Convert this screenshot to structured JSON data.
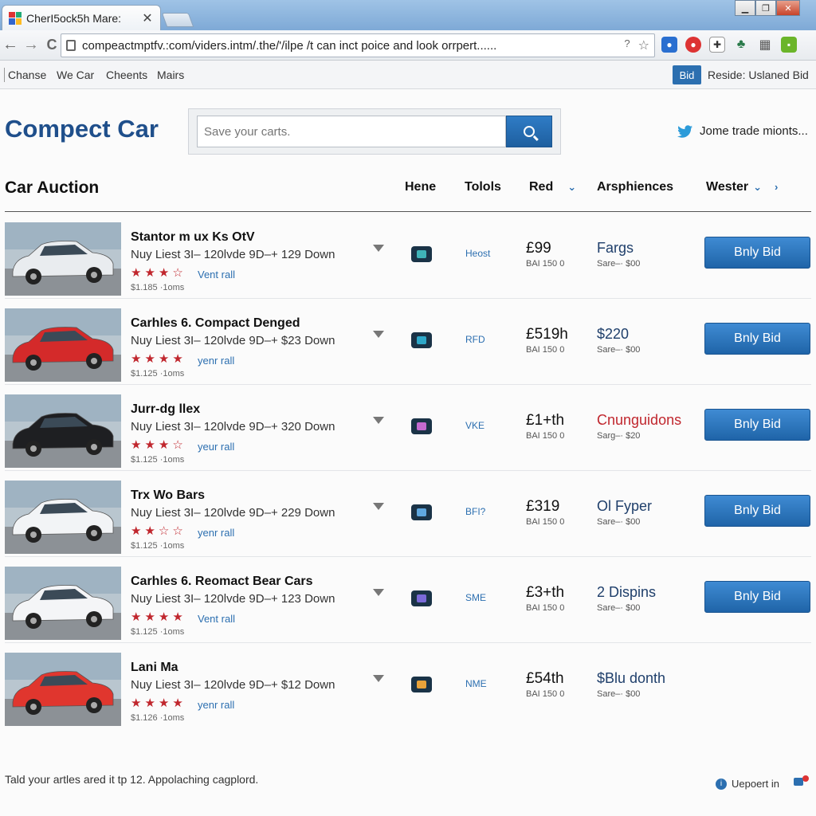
{
  "browser": {
    "tab_title": "CherI5ock5h Mare:",
    "tab_close": "✕",
    "url": "compeactmptfv.:com/viders.intm/.the/'/ilpe /t can inct poice and look orrpert......",
    "url_question": "?",
    "url_star": "☆",
    "nav_back": "←",
    "nav_forward": "→",
    "nav_reload": "C"
  },
  "bookmarks": [
    "Chanse",
    "We Car",
    "Cheents",
    "Mairs"
  ],
  "bookmark_bar": {
    "bid_badge": "Bid",
    "reside": "Reside: Uslaned Bid"
  },
  "header": {
    "logo": "Compect Car",
    "search_placeholder": "Save your carts.",
    "twitter_text": "Jome trade mionts..."
  },
  "section": {
    "title": "Car Auction",
    "columns": [
      "Hene",
      "Tolols",
      "Red",
      "Arsphiences",
      "Wester"
    ]
  },
  "listings": [
    {
      "title": "Stantor m ux Ks OtV",
      "subtitle": "Nuy Liest 3I– 120lvde 9D–+ 129 Down",
      "rating": 3,
      "rating_link": "Vent rall",
      "meta": "$1.185 ·1oms",
      "code": "Heost",
      "price": "£99",
      "price_sub": "BAI 150 0",
      "info": "Fargs",
      "info_sub": "Sare–· $00",
      "bid_label": "Bnly Bid",
      "car_color": "#e9ecef",
      "icon_color": "#3fb3b8"
    },
    {
      "title": "Carhles 6. Compact Denged",
      "subtitle": "Nuy Liest 3I– 120lvde 9D–+ $23 Down",
      "rating": 4,
      "rating_link": "yenr rall",
      "meta": "$1.125 ·1oms",
      "code": "RFD",
      "price": "£519h",
      "price_sub": "BAI 150 0",
      "info": "$220",
      "info_sub": "Sare–· $00",
      "bid_label": "Bnly Bid",
      "car_color": "#d42a2a",
      "icon_color": "#2ea8c9"
    },
    {
      "title": "Jurr-dg llex",
      "subtitle": "Nuy Liest 3I– 120lvde 9D–+ 320 Down",
      "rating": 3,
      "rating_link": "yeur rall",
      "meta": "$1.125 ·1oms",
      "code": "VKE",
      "price": "£1+th",
      "price_sub": "BAI 150 0",
      "info": "Cnunguidons",
      "info_red": true,
      "info_sub": "Sarg–· $20",
      "bid_label": "Bnly Bid",
      "car_color": "#1e1f22",
      "icon_color": "#c46ad0"
    },
    {
      "title": "Trx Wo Bars",
      "subtitle": "Nuy Liest 3I– 120lvde 9D–+ 229 Down",
      "rating": 2,
      "rating_link": "yenr rall",
      "meta": "$1.125 ·1oms",
      "code": "BFI?",
      "price": "£319",
      "price_sub": "BAI 150 0",
      "info": "Ol Fyper",
      "info_sub": "Sare–· $00",
      "bid_label": "Bnly Bid",
      "car_color": "#f2f4f6",
      "icon_color": "#5fa8e0"
    },
    {
      "title": "Carhles 6. Reomact Bear Cars",
      "subtitle": "Nuy Liest 3I– 120lvde 9D–+ 123 Down",
      "rating": 4,
      "rating_link": "Vent rall",
      "meta": "$1.125 ·1oms",
      "code": "SME",
      "price": "£3+th",
      "price_sub": "BAI 150 0",
      "info": "2 Dispins",
      "info_sub": "Sare–· $00",
      "bid_label": "Bnly Bid",
      "car_color": "#f4f5f7",
      "icon_color": "#7a6ad8"
    },
    {
      "title": "Lani Ma",
      "subtitle": "Nuy Liest 3I– 120lvde 9D–+ $12 Down",
      "rating": 4,
      "rating_link": "yenr rall",
      "meta": "$1.126 ·1oms",
      "code": "NME",
      "price": "£54th",
      "price_sub": "BAI 150 0",
      "info": "$Blu donth",
      "info_sub": "Sare–· $00",
      "bid_label": "",
      "car_color": "#e0362e",
      "icon_color": "#e8a23a"
    }
  ],
  "footer": {
    "text": "Tald your artles ared it tp 12. Appolaching cagplord.",
    "link": "Uepoert in",
    "info_glyph": "i"
  },
  "colors": {
    "brand_blue": "#1f4f8b",
    "button_blue": "#2c6fb0",
    "star_red": "#c0262d"
  }
}
